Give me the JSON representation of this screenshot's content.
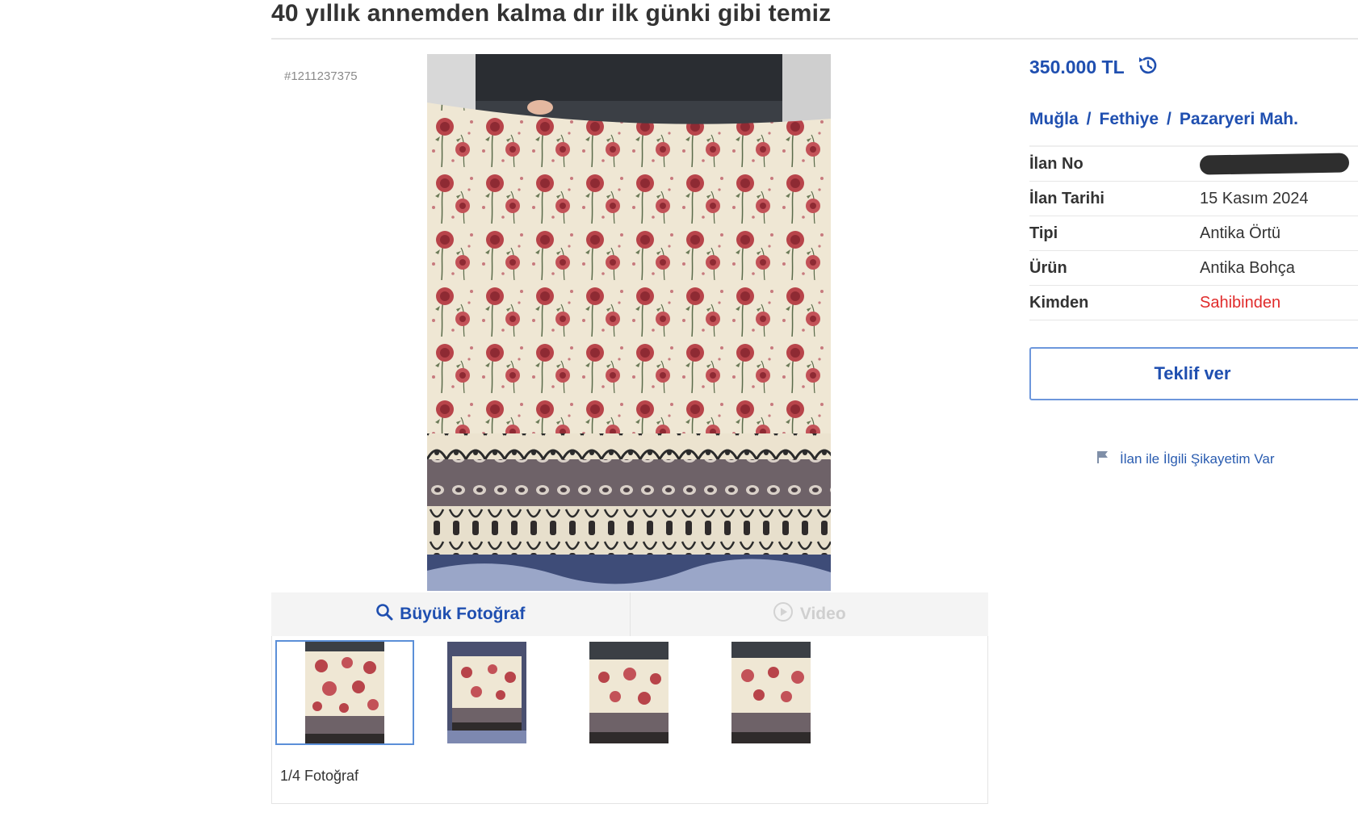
{
  "listing": {
    "title": "40 yıllık annemden kalma dır ilk günki gibi temiz",
    "ad_id": "#1211237375"
  },
  "gallery": {
    "big_photo_label": "Büyük Fotoğraf",
    "video_label": "Video",
    "photo_count": "1/4 Fotoğraf",
    "thumbnails": 4,
    "active_thumbnail": 1
  },
  "details": {
    "price": "350.000 TL",
    "breadcrumb": [
      "Muğla",
      "Fethiye",
      "Pazaryeri Mah."
    ],
    "breadcrumb_separator": "/",
    "rows": [
      {
        "label": "İlan No",
        "value": ""
      },
      {
        "label": "İlan Tarihi",
        "value": "15 Kasım 2024"
      },
      {
        "label": "Tipi",
        "value": "Antika Örtü"
      },
      {
        "label": "Ürün",
        "value": "Antika Bohça"
      },
      {
        "label": "Kimden",
        "value": "Sahibinden"
      }
    ],
    "offer_button": "Teklif ver",
    "report_link": "İlan ile İlgili Şikayetim Var"
  },
  "colors": {
    "link_blue": "#1f4fb0",
    "seller_red": "#e02b2b",
    "button_border": "#6d97dc"
  },
  "icons": [
    "price-history-icon",
    "search-icon",
    "play-icon",
    "flag-icon"
  ]
}
